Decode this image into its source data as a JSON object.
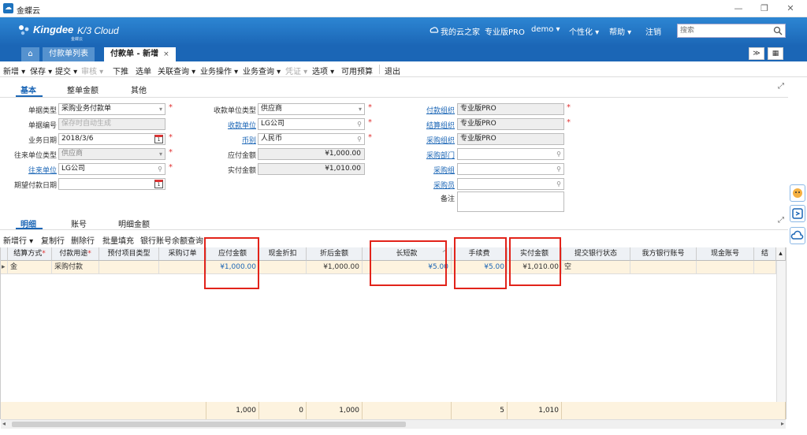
{
  "window": {
    "title": "金蝶云",
    "min": "—",
    "restore": "❐",
    "close": "✕"
  },
  "header": {
    "brand": "Kingdee",
    "brand_sub": "金蝶云",
    "product": "K/3 Cloud",
    "nav_home": "我的云之家",
    "nav_edition": "专业版PRO",
    "nav_user": "demo ▾",
    "nav_personal": "个性化 ▾",
    "nav_help": "帮助 ▾",
    "nav_logout": "注销",
    "search_placeholder": "搜索"
  },
  "tabs": {
    "home_icon": "⌂",
    "list_tab": "付款单列表",
    "active_tab": "付款单 - 新增",
    "close": "×",
    "more": "≫",
    "grid": "▦"
  },
  "toolbar": {
    "new": "新增 ▾",
    "save": "保存 ▾",
    "submit": "提交 ▾",
    "audit": "审核 ▾",
    "push": "下推",
    "select": "选单",
    "related": "关联查询 ▾",
    "bizop": "业务操作 ▾",
    "bizquery": "业务查询 ▾",
    "voucher": "凭证 ▾",
    "options": "选项 ▾",
    "budget": "可用预算",
    "exit": "退出"
  },
  "header_tabs": {
    "basic": "基本",
    "total": "整单金额",
    "other": "其他"
  },
  "form": {
    "doc_type_label": "单据类型",
    "doc_type": "采购业务付款单",
    "doc_no_label": "单据编号",
    "doc_no_placeholder": "保存时自动生成",
    "biz_date_label": "业务日期",
    "biz_date": "2018/3/6",
    "contact_type_label": "往来单位类型",
    "contact_type": "供应商",
    "contact_label": "往来单位",
    "contact": "LG公司",
    "expected_date_label": "期望付款日期",
    "expected_date": "",
    "payee_type_label": "收款单位类型",
    "payee_type": "供应商",
    "payee_label": "收款单位",
    "payee": "LG公司",
    "currency_label": "币别",
    "currency": "人民币",
    "payable_label": "应付金额",
    "payable": "¥1,000.00",
    "actual_label": "实付金额",
    "actual": "¥1,010.00",
    "pay_org_label": "付款组织",
    "pay_org": "专业版PRO",
    "settle_org_label": "结算组织",
    "settle_org": "专业版PRO",
    "purchase_org_label": "采购组织",
    "purchase_org": "专业版PRO",
    "purchase_dept_label": "采购部门",
    "purchase_group_label": "采购组",
    "purchaser_label": "采购员",
    "remark_label": "备注",
    "cal_day": "1",
    "search_icon": "🔍"
  },
  "detail_tabs": {
    "detail": "明细",
    "account": "账号",
    "detail_amount": "明细金额"
  },
  "grid_toolbar": {
    "new_row": "新增行 ▾",
    "copy_row": "复制行",
    "delete_row": "删除行",
    "batch_fill": "批量填充",
    "bank_balance": "银行账号余额查询"
  },
  "grid": {
    "headers": [
      "结算方式",
      "付款用途",
      "预付项目类型",
      "采购订单",
      "应付金额",
      "现金折扣",
      "折后金额",
      "长短款",
      "手续费",
      "实付金额",
      "提交银行状态",
      "我方银行账号",
      "现金账号",
      "结"
    ],
    "row": [
      "金",
      "采购付款",
      "",
      "",
      "¥1,000.00",
      "",
      "¥1,000.00",
      "¥5.00",
      "¥5.00",
      "¥1,010.00",
      "空",
      "",
      "",
      ""
    ],
    "footer": [
      "1,000",
      "0",
      "1,000",
      "",
      "5",
      "1,010"
    ],
    "row_marker": "▸",
    "sort_icon": "^"
  }
}
